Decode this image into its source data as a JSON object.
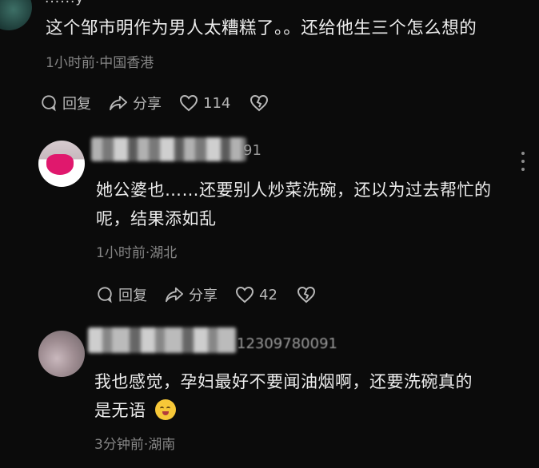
{
  "comments": [
    {
      "username_partial": "......y",
      "text_line1": "这个邹市明作为男人太糟糕了。。还给他生三个怎么想的",
      "meta": "1小时前·中国香港",
      "actions": {
        "reply": "回复",
        "share": "分享",
        "likes": "114"
      }
    },
    {
      "username_tail": "91",
      "text_line1": "她公婆也……还要别人炒菜洗碗，还以为过去帮忙的",
      "text_line2": "呢，结果添如乱",
      "meta": "1小时前·湖北",
      "actions": {
        "reply": "回复",
        "share": "分享",
        "likes": "42"
      }
    },
    {
      "username_tail": "12309780091",
      "text_line1": "我也感觉，孕妇最好不要闻油烟啊，还要洗碗真的",
      "text_line2": "是无语",
      "meta": "3分钟前·湖南"
    }
  ],
  "icons": {
    "reply": "reply-bubble-icon",
    "share": "share-arrow-icon",
    "like": "heart-outline-icon",
    "dislike": "broken-heart-icon",
    "more": "more-vertical-icon",
    "emoji": "blushing-face-emoji"
  },
  "colors": {
    "background": "#0b0b0b",
    "text": "#ececec",
    "meta": "#858585",
    "action": "#b8b8b8"
  }
}
